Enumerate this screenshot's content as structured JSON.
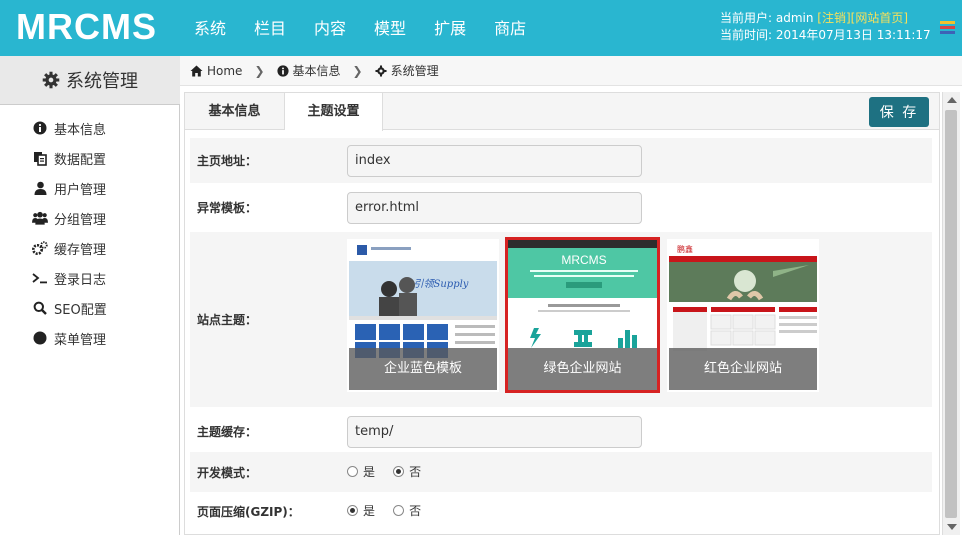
{
  "header": {
    "logo": "MRCMS",
    "nav": [
      "系统",
      "栏目",
      "内容",
      "模型",
      "扩展",
      "商店"
    ],
    "user_prefix": "当前用户: admin",
    "logout": "[注销]",
    "site_home": "[网站首页]",
    "time_line": "当前时间: 2014年07月13日 13:11:17",
    "menu_icon": "stack-icon"
  },
  "sidebar": {
    "title": "系统管理",
    "title_icon": "gear-icon",
    "items": [
      {
        "label": "基本信息",
        "icon": "info-circle-icon"
      },
      {
        "label": "数据配置",
        "icon": "files-icon"
      },
      {
        "label": "用户管理",
        "icon": "user-icon"
      },
      {
        "label": "分组管理",
        "icon": "users-icon"
      },
      {
        "label": "缓存管理",
        "icon": "gears-icon"
      },
      {
        "label": "登录日志",
        "icon": "terminal-icon"
      },
      {
        "label": "SEO配置",
        "icon": "search-icon"
      },
      {
        "label": "菜单管理",
        "icon": "circle-icon"
      }
    ]
  },
  "breadcrumb": {
    "home": "Home",
    "level1": "基本信息",
    "level2": "系统管理"
  },
  "tabs": {
    "items": [
      "基本信息",
      "主题设置"
    ],
    "active": "主题设置",
    "save_label": "保 存"
  },
  "form": {
    "homepage_label": "主页地址：",
    "homepage_value": "index",
    "error_label": "异常模板：",
    "error_value": "error.html",
    "theme_label": "站点主题：",
    "themes": [
      {
        "name": "企业蓝色模板",
        "selected": false
      },
      {
        "name": "绿色企业网站",
        "selected": true
      },
      {
        "name": "红色企业网站",
        "selected": false
      }
    ],
    "theme_preview_texts": {
      "green_logo": "MRCMS",
      "blue_banner": "引领Supply",
      "red_logo": "鹏鑫"
    },
    "cache_label": "主题缓存：",
    "cache_value": "temp/",
    "dev_label": "开发模式：",
    "dev_mode": "否",
    "gzip_label": "页面压缩(GZIP)：",
    "gzip": "是",
    "yes": "是",
    "no": "否"
  },
  "colors": {
    "header_bg": "#29b6d0",
    "save_button": "#1e7182",
    "selected_border": "#d62222",
    "link_yellow": "#f6e05a"
  }
}
